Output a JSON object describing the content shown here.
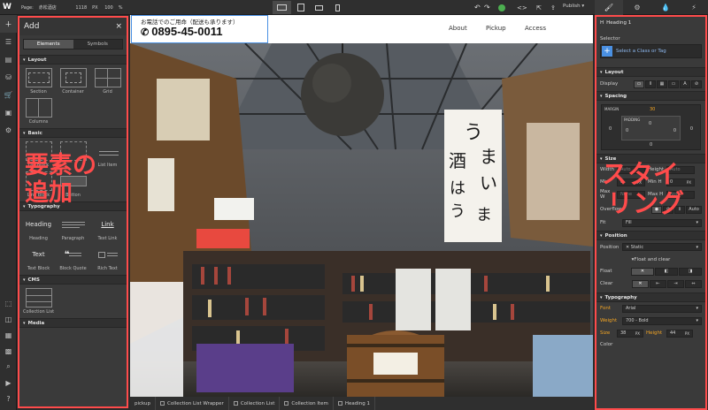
{
  "topbar": {
    "logo": "W",
    "page_label": "Page:",
    "page_name": "赤松酒店",
    "width_value": "1118",
    "width_unit": "PX",
    "zoom_value": "100",
    "zoom_unit": "%",
    "publish_label": "Publish"
  },
  "rail": {
    "icons": [
      "add-icon",
      "navigator-icon",
      "pages-icon",
      "cms-icon",
      "ecommerce-icon",
      "assets-icon",
      "settings-icon"
    ],
    "bottom_icons": [
      "select-icon",
      "preview-icon",
      "grid-icon",
      "mode-icon",
      "search-icon",
      "video-icon",
      "help-icon"
    ]
  },
  "add_panel": {
    "title": "Add",
    "close": "×",
    "tabs": [
      "Elements",
      "Symbols"
    ],
    "sections": {
      "layout": {
        "label": "Layout",
        "items": [
          "Section",
          "Container",
          "Grid",
          "Columns"
        ]
      },
      "basic": {
        "label": "Basic",
        "items": [
          "Div Block",
          "",
          "List Item",
          "Link Block",
          "Button"
        ]
      },
      "typography": {
        "label": "Typography",
        "items": [
          {
            "preview": "Heading",
            "label": "Heading"
          },
          {
            "preview": "",
            "label": "Paragraph"
          },
          {
            "preview": "Link",
            "label": "Text Link"
          },
          {
            "preview": "Text",
            "label": "Text Block"
          },
          {
            "preview": "",
            "label": "Block Quote"
          },
          {
            "preview": "",
            "label": "Rich Text"
          }
        ]
      },
      "cms": {
        "label": "CMS",
        "items": [
          "Collection List"
        ]
      },
      "media": {
        "label": "Media"
      }
    },
    "overlay_text_line1": "要素の",
    "overlay_text_line2": "追加"
  },
  "canvas": {
    "note": "お電話でのご用命（配送も承ります）",
    "phone": "0895-45-0011",
    "nav": [
      "About",
      "Pickup",
      "Access"
    ],
    "selected_label": "Heading 1"
  },
  "breadcrumbs": [
    "pickup",
    "Collection List Wrapper",
    "Collection List",
    "Collection Item",
    "Heading 1"
  ],
  "style_panel": {
    "element_label": "Heading 1",
    "selector_label": "Selector",
    "selector_placeholder": "Select a Class or Tag",
    "overlay_text_line1": "スタイ",
    "overlay_text_line2": "リング",
    "layout": {
      "label": "Layout",
      "display_label": "Display"
    },
    "spacing": {
      "label": "Spacing",
      "margin_label": "MARGIN",
      "margin_top": "30",
      "padding_label": "PADDING",
      "values": [
        "0",
        "0",
        "0",
        "0",
        "0",
        "0"
      ]
    },
    "size": {
      "label": "Size",
      "width_label": "Width",
      "width_value": "Auto",
      "height_label": "Height",
      "height_value": "Auto",
      "min_label": "Min",
      "min_w": "0",
      "min_w_unit": "PX",
      "min_h_label": "Min H",
      "min_h": "0",
      "min_h_unit": "PX",
      "max_w_label": "Max W",
      "max_w": "None",
      "max_h_label": "Max H",
      "max_h": "None"
    },
    "overflow_label": "Overflow",
    "overflow_auto": "Auto",
    "fit_label": "Fit",
    "fit_value": "Fill",
    "position": {
      "label": "Position",
      "position_label": "Position",
      "position_value": "Static",
      "float_clear": "Float and clear",
      "float_label": "Float",
      "clear_label": "Clear"
    },
    "typography": {
      "label": "Typography",
      "font_label": "Font",
      "font_value": "Arial",
      "weight_label": "Weight",
      "weight_value": "700 - Bold",
      "size_label": "Size",
      "size_value": "38",
      "size_unit": "PX",
      "height_label": "Height",
      "height_value": "44",
      "height_unit": "PX",
      "color_label": "Color"
    }
  },
  "colors": {
    "annotation_red": "#ff4b4b",
    "accent_orange": "#f5a623",
    "accent_blue": "#4a90e2"
  }
}
